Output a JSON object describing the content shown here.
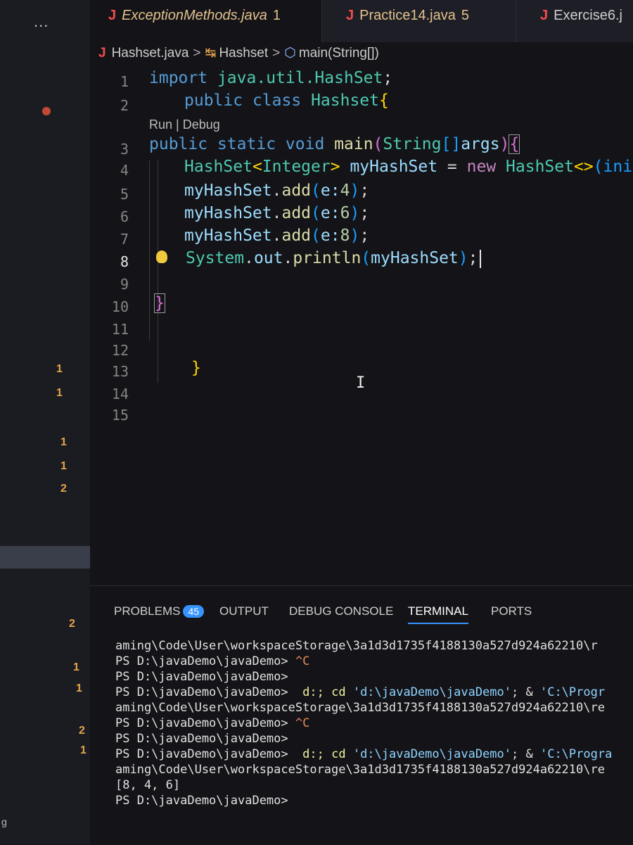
{
  "sidebar": {
    "more_label": "...",
    "badges": [
      {
        "text": "1",
        "color": "#e5a44b"
      },
      {
        "text": "1",
        "color": "#e5a44b"
      },
      {
        "text": "1",
        "color": "#e5a44b"
      },
      {
        "text": "1",
        "color": "#e5a44b"
      },
      {
        "text": "2",
        "color": "#e5a44b"
      },
      {
        "text": "2",
        "color": "#e5a44b"
      },
      {
        "text": "1",
        "color": "#e5a44b"
      },
      {
        "text": "1",
        "color": "#e5a44b"
      },
      {
        "text": "2",
        "color": "#e5a44b"
      },
      {
        "text": "1",
        "color": "#e5a44b"
      }
    ],
    "edge_char": "g"
  },
  "tabs": [
    {
      "icon": "J",
      "name": "ExceptionMethods.java",
      "count": "1"
    },
    {
      "icon": "J",
      "name": "Practice14.java",
      "count": "5"
    },
    {
      "icon": "J",
      "name": "Exercise6.j",
      "count": ""
    }
  ],
  "breadcrumb": {
    "file_icon": "J",
    "file": "Hashset.java",
    "class": "Hashset",
    "method": "main(String[])"
  },
  "editor": {
    "line_numbers": [
      "1",
      "2",
      "3",
      "4",
      "5",
      "6",
      "7",
      "8",
      "9",
      "10",
      "11",
      "12",
      "13",
      "14",
      "15"
    ],
    "active_line": "8",
    "codelens": "Run | Debug",
    "lines": {
      "l1": {
        "kw": "import",
        "pkg": "java.util.HashSet",
        "end": ";"
      },
      "l2": {
        "kw1": "public",
        "kw2": "class",
        "name": "Hashset",
        "brace": "{"
      },
      "l3": {
        "kw1": "public",
        "kw2": "static",
        "kw3": "void",
        "fn": "main",
        "p1": "(",
        "type": "String",
        "arr": "[]",
        "param": "args",
        "p2": ")",
        "brace": "{"
      },
      "l4": {
        "type": "HashSet",
        "lt": "<",
        "gen": "Integer",
        "gt": ">",
        "var": "myHashSet",
        "eq": " = ",
        "kw": "new",
        "type2": "HashSet",
        "diamond": "<>",
        "rest": "(initia"
      },
      "l5": {
        "var": "myHashSet",
        "dot": ".",
        "fn": "add",
        "p1": "(",
        "hint": "e:",
        "num": "4",
        "p2": ")",
        "end": ";"
      },
      "l6": {
        "var": "myHashSet",
        "dot": ".",
        "fn": "add",
        "p1": "(",
        "hint": "e:",
        "num": "6",
        "p2": ")",
        "end": ";"
      },
      "l7": {
        "var": "myHashSet",
        "dot": ".",
        "fn": "add",
        "p1": "(",
        "hint": "e:",
        "num": "8",
        "p2": ")",
        "end": ";"
      },
      "l8": {
        "cls": "System",
        "dot1": ".",
        "out": "out",
        "dot2": ".",
        "fn": "println",
        "p1": "(",
        "var": "myHashSet",
        "p2": ")",
        "end": ";"
      },
      "l10": {
        "brace": "}"
      },
      "l13": {
        "brace": "}"
      }
    }
  },
  "panel": {
    "tabs": [
      {
        "label": "PROBLEMS",
        "badge": "45"
      },
      {
        "label": "OUTPUT"
      },
      {
        "label": "DEBUG CONSOLE"
      },
      {
        "label": "TERMINAL"
      },
      {
        "label": "PORTS"
      }
    ],
    "active_tab": "TERMINAL",
    "terminal": {
      "l1": "aming\\Code\\User\\workspaceStorage\\3a1d3d1735f4188130a527d924a62210\\r",
      "prompt": "PS D:\\javaDemo\\javaDemo>",
      "ctrl_c": "^C",
      "cmd_d": "d:;",
      "cmd_cd": "cd",
      "path_str": "'d:\\javaDemo\\javaDemo'",
      "amp": "; &",
      "prog_str_a": "'C:\\Progr",
      "prog_str_b": "'C:\\Progra",
      "l_aming_a": "aming\\Code\\User\\workspaceStorage\\3a1d3d1735f4188130a527d924a62210\\re",
      "l_aming_b": "aming\\Code\\User\\workspaceStorage\\3a1d3d1735f4188130a527d924a62210\\re",
      "output": "[8, 4, 6]"
    }
  }
}
